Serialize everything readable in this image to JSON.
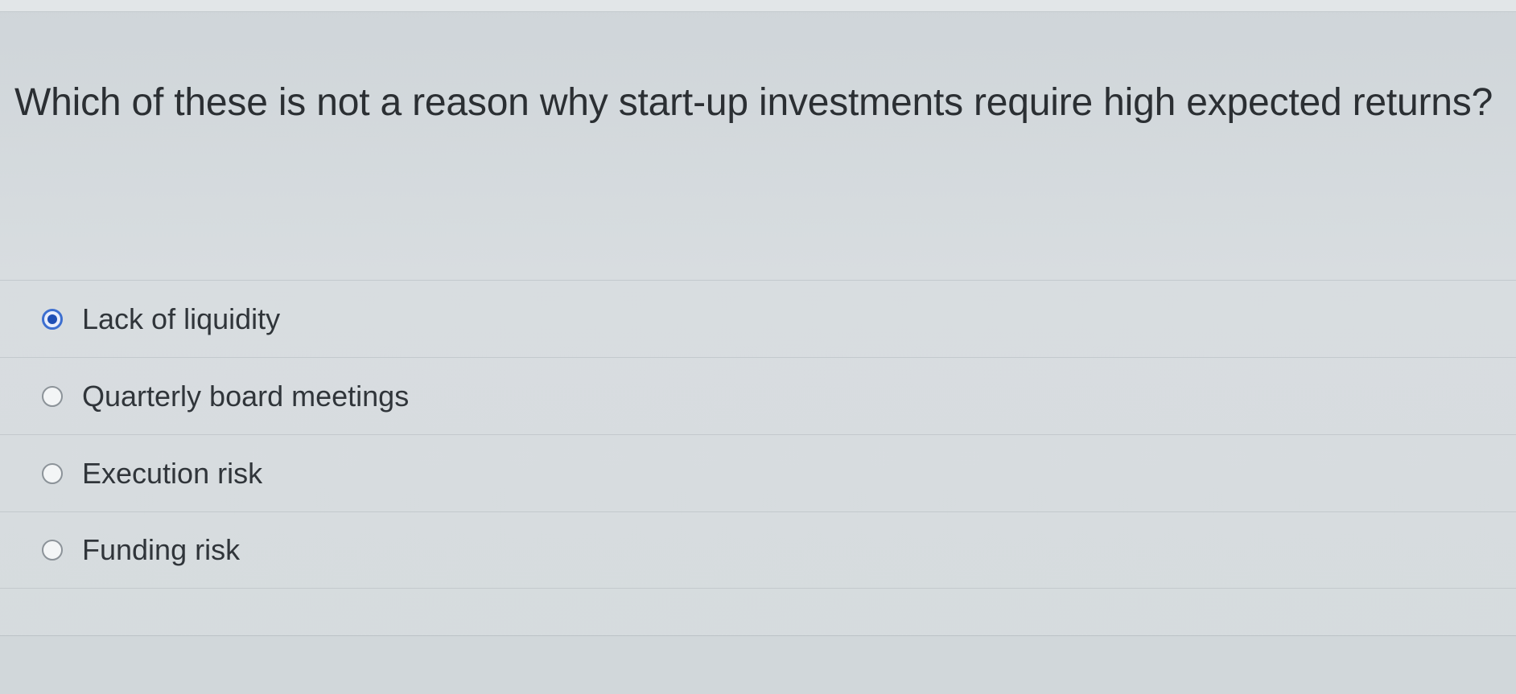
{
  "question": {
    "text": "Which of these is not a reason why start-up investments require high expected returns?"
  },
  "options": [
    {
      "label": "Lack of liquidity",
      "selected": true
    },
    {
      "label": "Quarterly board meetings",
      "selected": false
    },
    {
      "label": "Execution risk",
      "selected": false
    },
    {
      "label": "Funding risk",
      "selected": false
    }
  ],
  "colors": {
    "background": "#d6dbde",
    "radio_selected": "#1f4fb5",
    "text": "#2d3136"
  },
  "icons": {
    "radio_checked": "radio-checked-icon",
    "radio_unchecked": "radio-unchecked-icon"
  }
}
